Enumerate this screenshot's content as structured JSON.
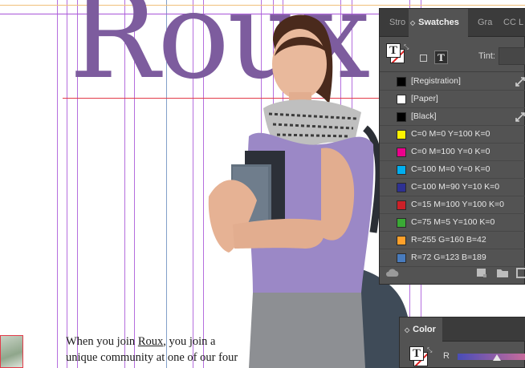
{
  "document": {
    "headline": "Roux",
    "body_lines": [
      [
        "When you join ",
        "Roux",
        ", you join a"
      ],
      [
        "unique community at one of our four"
      ]
    ]
  },
  "swatches_panel": {
    "tabs": [
      "Stro",
      "Swatches",
      "Gra",
      "CC L"
    ],
    "tint_label": "Tint:",
    "fill_glyph": "T",
    "text_toggle": "T",
    "swatches": [
      {
        "name": "[Registration]",
        "color": "#000000",
        "locked": true
      },
      {
        "name": "[Paper]",
        "color": "#ffffff",
        "locked": false
      },
      {
        "name": "[Black]",
        "color": "#000000",
        "locked": true
      },
      {
        "name": "C=0 M=0 Y=100 K=0",
        "color": "#fff200",
        "locked": false
      },
      {
        "name": "C=0 M=100 Y=0 K=0",
        "color": "#ec008c",
        "locked": false
      },
      {
        "name": "C=100 M=0 Y=0 K=0",
        "color": "#00aeef",
        "locked": false
      },
      {
        "name": "C=100 M=90 Y=10 K=0",
        "color": "#2e3192",
        "locked": false
      },
      {
        "name": "C=15 M=100 Y=100 K=0",
        "color": "#cc2028",
        "locked": false
      },
      {
        "name": "C=75 M=5 Y=100 K=0",
        "color": "#3aa935",
        "locked": false
      },
      {
        "name": "R=255 G=160 B=42",
        "color": "#ffa02a",
        "locked": false
      },
      {
        "name": "R=72 G=123 B=189",
        "color": "#487bbd",
        "locked": false
      }
    ]
  },
  "color_panel": {
    "title": "Color",
    "channel_label": "R",
    "fill_glyph": "T"
  }
}
